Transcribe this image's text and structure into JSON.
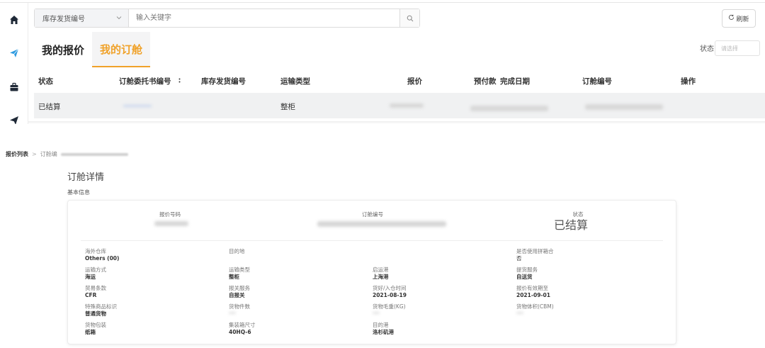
{
  "search": {
    "field_select": "库存发货编号",
    "placeholder": "输入关键字"
  },
  "toolbar": {
    "refresh_label": "刷新"
  },
  "tabs": [
    {
      "label": "我的报价",
      "active": false
    },
    {
      "label": "我的订舱",
      "active": true
    }
  ],
  "filter": {
    "status_label": "状态",
    "status_placeholder": "请选择"
  },
  "table": {
    "columns": [
      "状态",
      "订舱委托书编号",
      "库存发货编号",
      "运输类型",
      "报价",
      "预付款",
      "完成日期",
      "订舱编号",
      "操作"
    ],
    "rows": [
      {
        "status": "已结算",
        "transport_type": "整柜"
      }
    ]
  },
  "breadcrumb": {
    "parent": "报价列表",
    "separator": ">",
    "current": "订舱编"
  },
  "detail": {
    "title": "订舱详情",
    "section_title": "基本信息",
    "quote_no_label": "报价号码",
    "booking_no_label": "订舱编号",
    "status_label": "状态",
    "status_value": "已结算",
    "fields": [
      {
        "label": "海外仓库",
        "value": "Others (00)"
      },
      {
        "label": "目的地",
        "value": ""
      },
      {
        "label": "是否使用拼箱合",
        "value": "否"
      },
      {
        "label": "运输方式",
        "value": "海运"
      },
      {
        "label": "运输类型",
        "value": "整柜"
      },
      {
        "label": "启运港",
        "value": "上海港"
      },
      {
        "label": "提货服务",
        "value": "自送货"
      },
      {
        "label": "贸易条款",
        "value": "CFR"
      },
      {
        "label": "报关服务",
        "value": "自报关"
      },
      {
        "label": "货好/入仓时间",
        "value": "2021-08-19"
      },
      {
        "label": "报价有效期至",
        "value": "2021-09-01"
      },
      {
        "label": "特殊商品标识",
        "value": "普通货物"
      },
      {
        "label": "货物件数",
        "value": ""
      },
      {
        "label": "货物毛重(KG)",
        "value": ""
      },
      {
        "label": "货物体积(CBM)",
        "value": ""
      },
      {
        "label": "货物包装",
        "value": "纸箱"
      },
      {
        "label": "集装箱尺寸",
        "value": "40HQ-6"
      },
      {
        "label": "目的港",
        "value": "洛杉矶港"
      }
    ]
  },
  "colors": {
    "accent": "#f0a22a",
    "nav_active": "#2f9be0",
    "row_bg": "#f0f1f2"
  },
  "icons": [
    "home-icon",
    "paper-plane-icon",
    "briefcase-icon",
    "send-icon",
    "chevron-down-icon",
    "search-icon",
    "refresh-icon"
  ]
}
